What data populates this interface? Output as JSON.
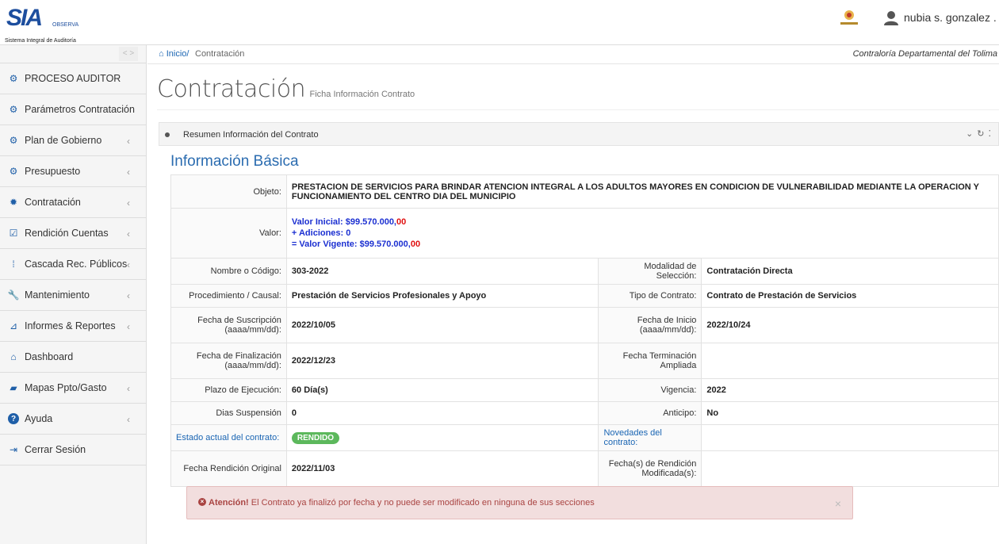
{
  "header": {
    "logo_text": "SIA",
    "logo_observa": "OBSERVA",
    "logo_subtitle": "Sistema Integral de Auditoría",
    "user_name": "nubia s. gonzalez ."
  },
  "sidebar": {
    "items": [
      {
        "label": "PROCESO AUDITOR",
        "icon": "gears-icon",
        "chevron": false
      },
      {
        "label": "Parámetros Contratación",
        "icon": "gears-icon",
        "chevron": false
      },
      {
        "label": "Plan de Gobierno",
        "icon": "gears-icon",
        "chevron": true
      },
      {
        "label": "Presupuesto",
        "icon": "gears-icon",
        "chevron": true
      },
      {
        "label": "Contratación",
        "icon": "gear-icon",
        "chevron": true
      },
      {
        "label": "Rendición Cuentas",
        "icon": "check-square-icon",
        "chevron": true
      },
      {
        "label": "Cascada Rec. Públicos",
        "icon": "grid-dots-icon",
        "chevron": true
      },
      {
        "label": "Mantenimiento",
        "icon": "wrench-icon",
        "chevron": true
      },
      {
        "label": "Informes & Reportes",
        "icon": "line-chart-icon",
        "chevron": true
      },
      {
        "label": "Dashboard",
        "icon": "home-icon",
        "chevron": false
      },
      {
        "label": "Mapas Ppto/Gasto",
        "icon": "book-icon",
        "chevron": true
      },
      {
        "label": "Ayuda",
        "icon": "question-icon",
        "chevron": true
      },
      {
        "label": "Cerrar Sesión",
        "icon": "sign-out-icon",
        "chevron": false
      }
    ]
  },
  "breadcrumb": {
    "home": "Inicio/",
    "current": "Contratación",
    "organization": "Contraloría Departamental del Tolima"
  },
  "page": {
    "title": "Contratación",
    "subtitle": "Ficha Información Contrato"
  },
  "panel": {
    "title": "Resumen Información del Contrato",
    "section_title": "Información Básica"
  },
  "contract": {
    "objeto_label": "Objeto:",
    "objeto": "PRESTACION DE SERVICIOS PARA BRINDAR ATENCION INTEGRAL A LOS ADULTOS MAYORES EN CONDICION DE VULNERABILIDAD MEDIANTE LA OPERACION Y FUNCIONAMIENTO DEL CENTRO DIA DEL MUNICIPIO",
    "valor_label": "Valor:",
    "valor_inicial_label": "Valor Inicial: ",
    "valor_inicial": "$99.570.000,",
    "valor_inicial_cents": "00",
    "adiciones_label": "+ Adiciones: ",
    "adiciones": "0",
    "valor_vigente_label": "= Valor Vigente: ",
    "valor_vigente": "$99.570.000,",
    "valor_vigente_cents": "00",
    "nombre_label": "Nombre o Código:",
    "nombre": "303-2022",
    "modalidad_label": "Modalidad de Selección:",
    "modalidad": "Contratación Directa",
    "procedimiento_label": "Procedimiento / Causal:",
    "procedimiento": "Prestación de Servicios Profesionales y Apoyo",
    "tipo_label": "Tipo de Contrato:",
    "tipo": "Contrato de Prestación de Servicios",
    "suscripcion_label": "Fecha de Suscripción (aaaa/mm/dd):",
    "suscripcion": "2022/10/05",
    "inicio_label": "Fecha de Inicio (aaaa/mm/dd):",
    "inicio": "2022/10/24",
    "finalizacion_label": "Fecha de Finalización (aaaa/mm/dd):",
    "finalizacion": "2022/12/23",
    "terminacion_label": "Fecha Terminación Ampliada",
    "terminacion": "",
    "plazo_label": "Plazo de Ejecución:",
    "plazo": "60 Día(s)",
    "vigencia_label": "Vigencia:",
    "vigencia": "2022",
    "suspension_label": "Dias Suspensión",
    "suspension": "0",
    "anticipo_label": "Anticipo:",
    "anticipo": "No",
    "estado_label": "Estado actual del contrato:",
    "estado": "RENDIDO",
    "novedades_label": "Novedades del contrato:",
    "novedades": "",
    "rendicion_label": "Fecha Rendición Original",
    "rendicion": "2022/11/03",
    "rendicion_mod_label": "Fecha(s) de Rendición Modificada(s):",
    "rendicion_mod": ""
  },
  "alert": {
    "strong": "Atención!",
    "text": " El Contrato ya finalizó por fecha y no puede ser modificado en ninguna de sus secciones",
    "close": "×"
  },
  "colors": {
    "accent": "#2b6cb0",
    "badge_green": "#5cb85c",
    "alert_bg": "#f2dede",
    "alert_text": "#a94442"
  }
}
